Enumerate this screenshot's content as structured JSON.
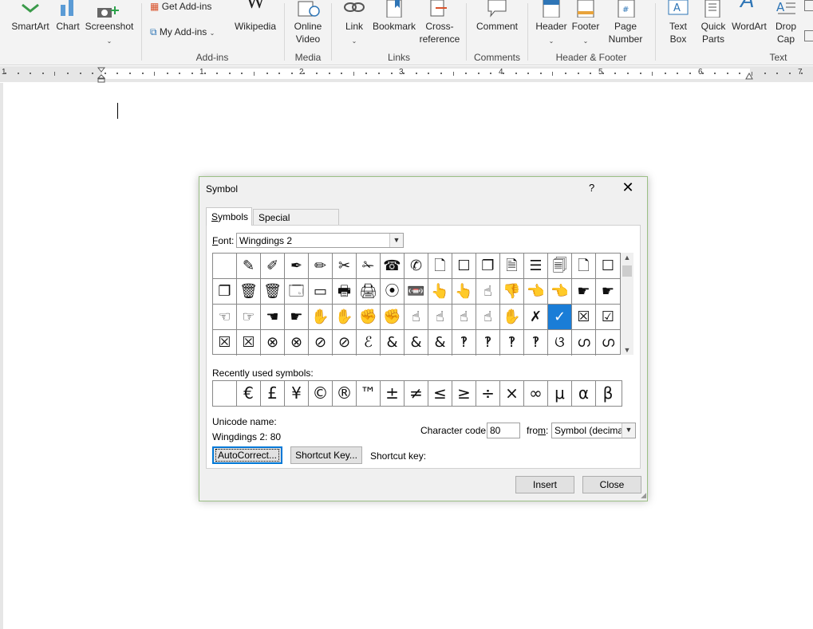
{
  "ribbon": {
    "buttons": [
      {
        "label": "SmartArt"
      },
      {
        "label": "Chart"
      },
      {
        "label": "Screenshot"
      },
      {
        "label": "Wikipedia"
      },
      {
        "label": "Online\nVideo"
      },
      {
        "label": "Link"
      },
      {
        "label": "Bookmark"
      },
      {
        "label": "Cross-\nreference"
      },
      {
        "label": "Comment"
      },
      {
        "label": "Header"
      },
      {
        "label": "Footer"
      },
      {
        "label": "Page\nNumber"
      },
      {
        "label": "Text\nBox"
      },
      {
        "label": "Quick\nParts"
      },
      {
        "label": "WordArt"
      },
      {
        "label": "Drop\nCap"
      }
    ],
    "get_addins": "Get Add-ins",
    "my_addins": "My Add-ins",
    "groups": {
      "addins": "Add-ins",
      "media": "Media",
      "links": "Links",
      "comments": "Comments",
      "header_footer": "Header & Footer",
      "text": "Text"
    }
  },
  "ruler": {
    "numbers": [
      "1",
      "1",
      "2",
      "3",
      "4",
      "5",
      "6",
      "7"
    ]
  },
  "dialog": {
    "title": "Symbol",
    "help": "?",
    "close": "✕",
    "tabs": [
      {
        "label": "Symbols",
        "active": true
      },
      {
        "label": "Special Characters",
        "active": false
      }
    ],
    "font_label": "Font:",
    "font_value": "Wingdings 2",
    "symbols": [
      [
        "",
        "✎",
        "✐",
        "✒",
        "✏",
        "✂",
        "✁",
        "☎",
        "✆",
        "🗋",
        "☐",
        "❐",
        "🗎",
        "☰",
        "🗐",
        "🗋",
        "☐"
      ],
      [
        "❐",
        "🗑",
        "🗑",
        "🗔",
        "▭",
        "🖶",
        "🖨",
        "⦿",
        "📼",
        "👆",
        "👆",
        "☝",
        "👎",
        "👈",
        "👈",
        "☛",
        "☛"
      ],
      [
        "☜",
        "☞",
        "☚",
        "☛",
        "✋",
        "✋",
        "✊",
        "✊",
        "☝",
        "☝",
        "☝",
        "☝",
        "✋",
        "✗",
        "✓",
        "☒",
        "☑"
      ],
      [
        "☒",
        "☒",
        "⊗",
        "⊗",
        "⊘",
        "⊘",
        "ℰ",
        "&",
        "&",
        "&",
        "‽",
        "‽",
        "‽",
        "‽",
        "ଓ",
        "ഗ",
        "ഗ"
      ]
    ],
    "selected_cell": "2,14",
    "recent_label": "Recently used symbols:",
    "recent": [
      "",
      "€",
      "£",
      "¥",
      "©",
      "®",
      "™",
      "±",
      "≠",
      "≤",
      "≥",
      "÷",
      "×",
      "∞",
      "μ",
      "α",
      "β"
    ],
    "unicode_label": "Unicode name:",
    "unicode_value": "Wingdings 2: 80",
    "charcode_label": "Character code:",
    "charcode_value": "80",
    "from_label": "from:",
    "from_value": "Symbol (decimal)",
    "autocorrect": "AutoCorrect...",
    "shortcut_key_btn": "Shortcut Key...",
    "shortcut_key_label": "Shortcut key:",
    "insert": "Insert",
    "close_btn": "Close"
  }
}
